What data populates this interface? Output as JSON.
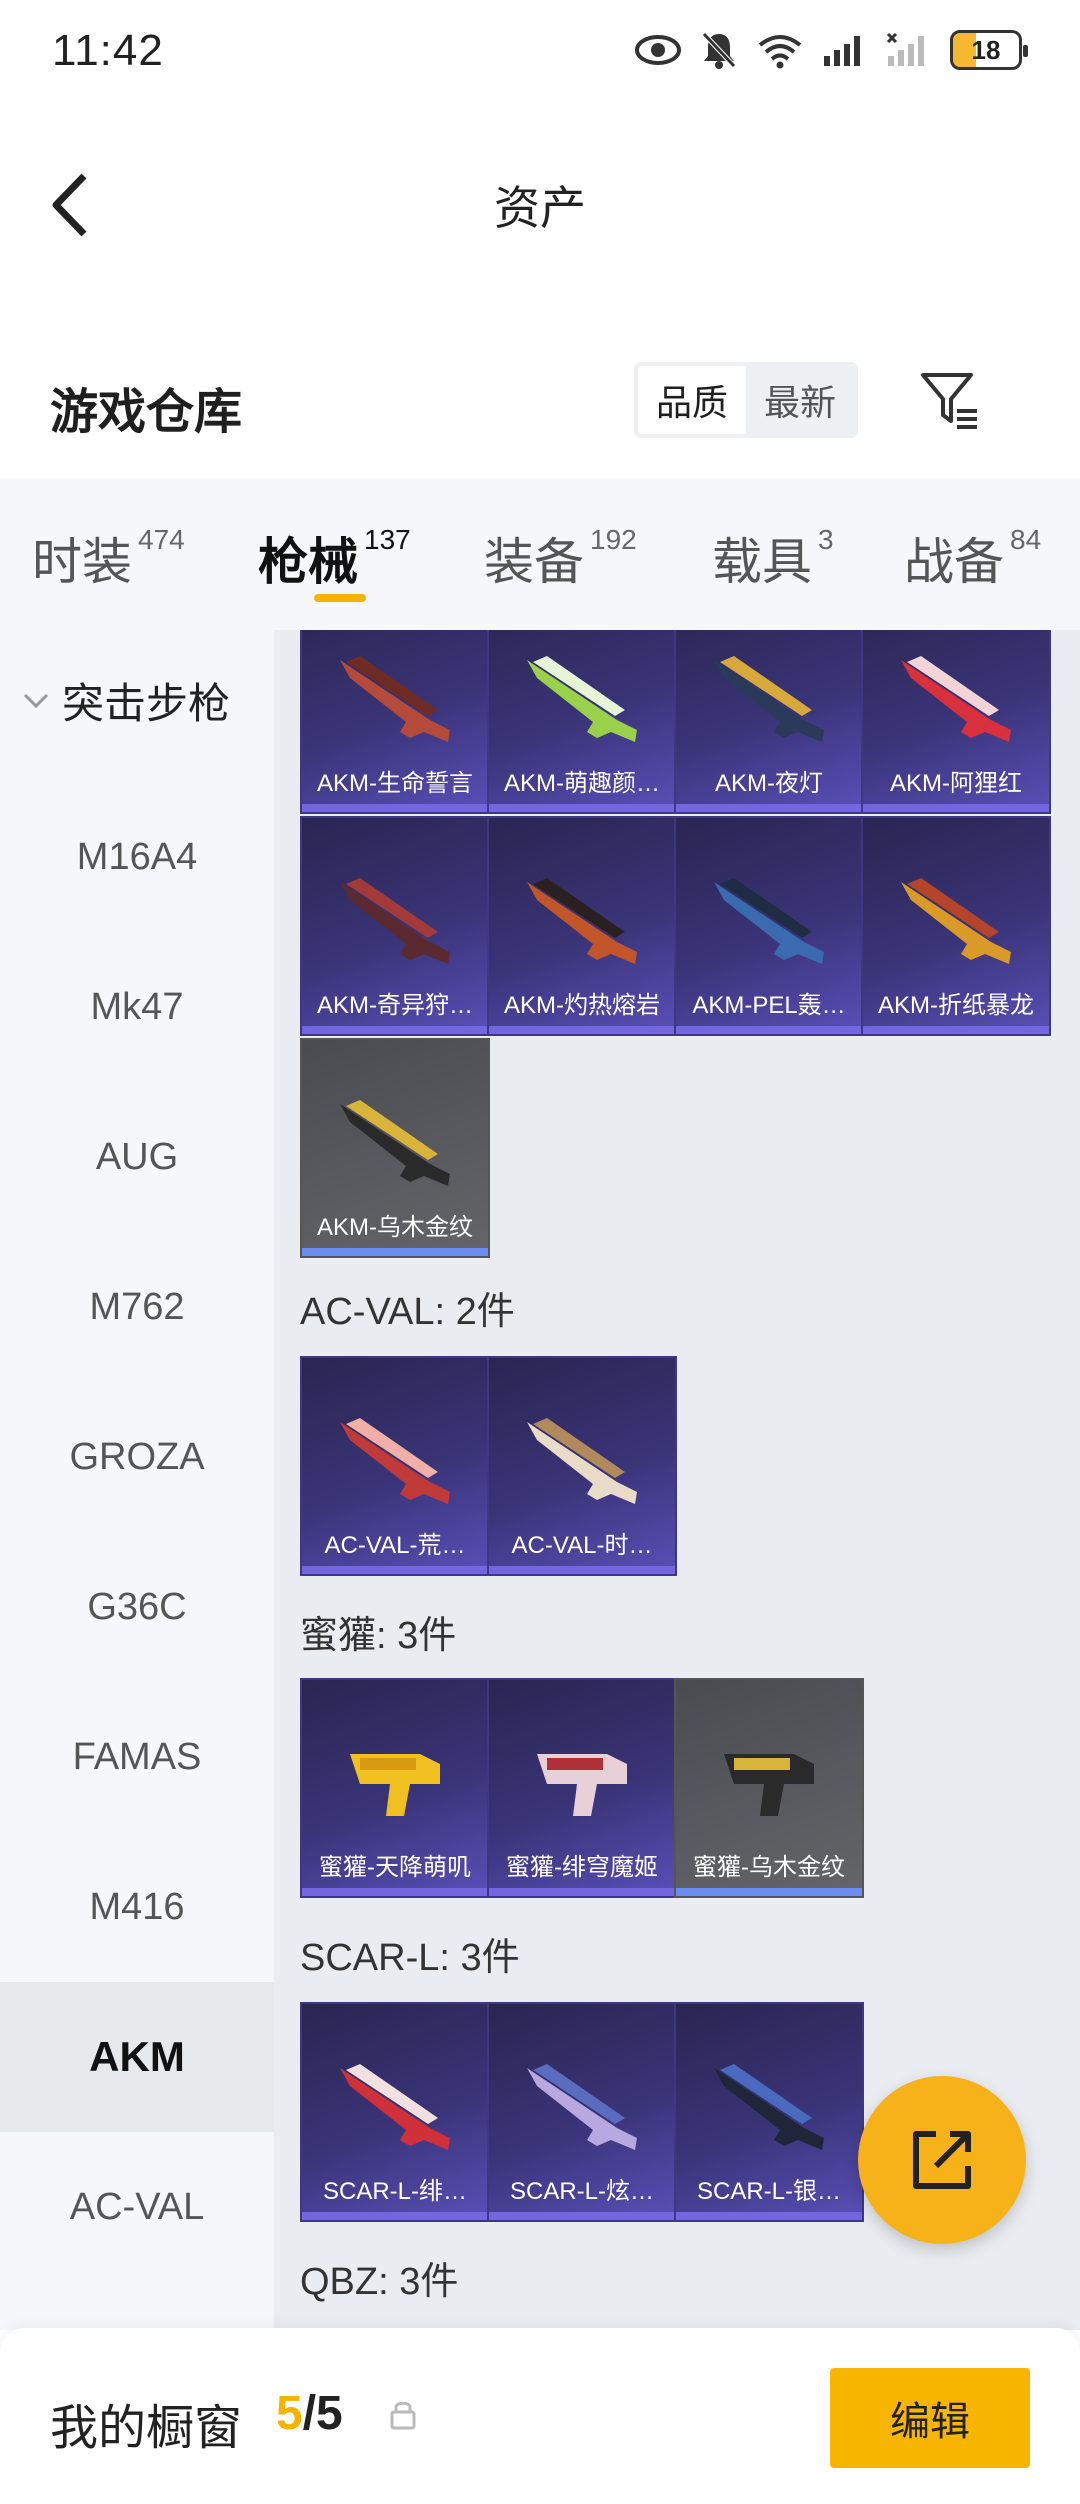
{
  "status_bar": {
    "time": "11:42",
    "battery": "18"
  },
  "nav": {
    "title": "资产"
  },
  "section": {
    "title": "游戏仓库",
    "sort_options": [
      "品质",
      "最新"
    ],
    "active_sort": "品质"
  },
  "tabs": [
    {
      "label": "时装",
      "count": "474"
    },
    {
      "label": "枪械",
      "count": "137",
      "active": true
    },
    {
      "label": "装备",
      "count": "192"
    },
    {
      "label": "载具",
      "count": "3"
    },
    {
      "label": "战备",
      "count": "84"
    }
  ],
  "sidebar": {
    "group": "突击步枪",
    "items": [
      "M16A4",
      "Mk47",
      "AUG",
      "M762",
      "GROZA",
      "G36C",
      "FAMAS",
      "M416",
      "AKM",
      "AC-VAL"
    ],
    "active": "AKM"
  },
  "groups": {
    "akm": {
      "items": [
        "AKM-生命誓言",
        "AKM-萌趣颜…",
        "AKM-夜灯",
        "AKM-阿狸红",
        "AKM-奇异狩…",
        "AKM-灼热熔岩",
        "AKM-PEL轰…",
        "AKM-折纸暴龙",
        "AKM-乌木金纹"
      ]
    },
    "acval": {
      "title": "AC-VAL: 2件",
      "items": [
        "AC-VAL-荒…",
        "AC-VAL-时…"
      ]
    },
    "mihuo": {
      "title": "蜜獾: 3件",
      "items": [
        "蜜獾-天降萌叽",
        "蜜獾-绯穹魔姬",
        "蜜獾-乌木金纹"
      ]
    },
    "scarl": {
      "title": "SCAR-L: 3件",
      "items": [
        "SCAR-L-绯…",
        "SCAR-L-炫…",
        "SCAR-L-银…"
      ]
    },
    "qbz": {
      "title": "QBZ: 3件"
    }
  },
  "bottom": {
    "label": "我的橱窗",
    "current": "5",
    "total": "/5",
    "edit": "编辑"
  },
  "colors": {
    "accent": "#f7b500",
    "card_purple": "#3a3478",
    "card_gray": "#55565b"
  }
}
